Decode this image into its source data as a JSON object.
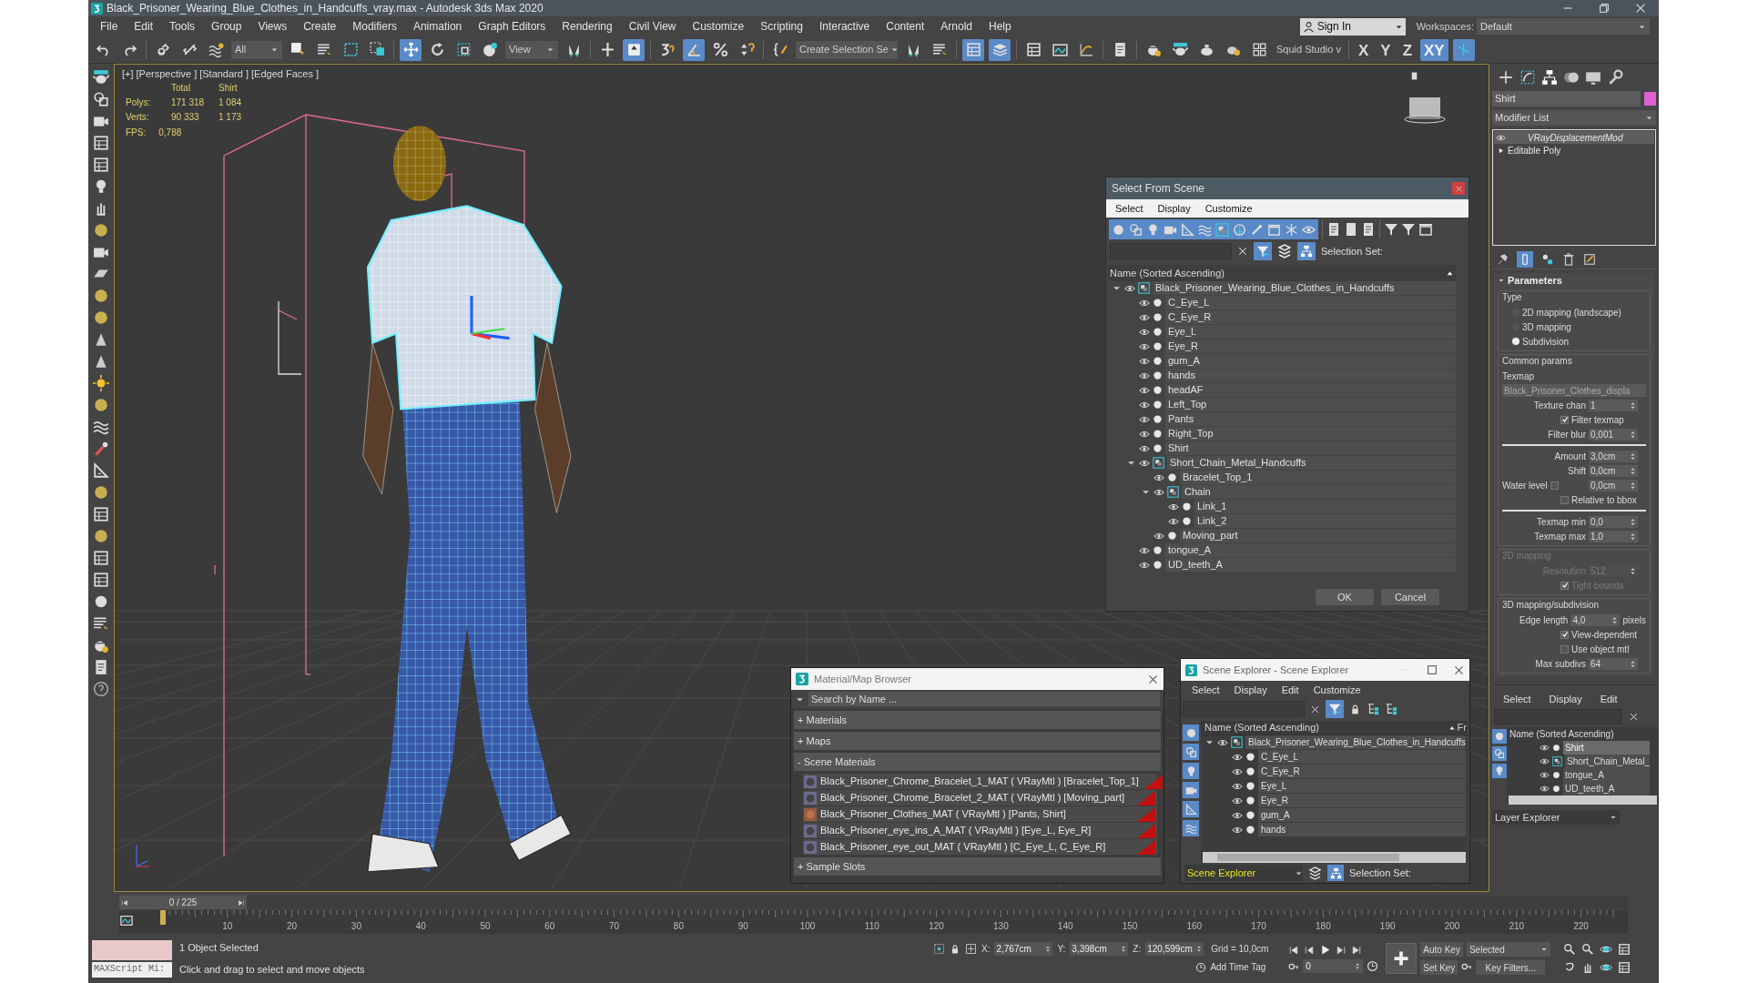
{
  "window": {
    "title": "Black_Prisoner_Wearing_Blue_Clothes_in_Handcuffs_vray.max - Autodesk 3ds Max 2020"
  },
  "menu": [
    "File",
    "Edit",
    "Tools",
    "Group",
    "Views",
    "Create",
    "Modifiers",
    "Animation",
    "Graph Editors",
    "Rendering",
    "Civil View",
    "Customize",
    "Scripting",
    "Interactive",
    "Content",
    "Arnold",
    "Help"
  ],
  "account": {
    "sign_in": "Sign In",
    "workspaces_label": "Workspaces:",
    "workspace": "Default"
  },
  "toolbar": {
    "selection_filter": "All",
    "reference_coordinate": "View",
    "named_selection": "Create Selection Se",
    "workspace_menu": "Squid Studio v",
    "axes": [
      {
        "label": "X",
        "selected": false
      },
      {
        "label": "Y",
        "selected": false
      },
      {
        "label": "Z",
        "selected": false
      },
      {
        "label": "XY",
        "selected": true
      }
    ]
  },
  "viewport": {
    "labels": [
      "[+]",
      "[Perspective ]",
      "[Standard ]",
      "[Edged Faces ]"
    ],
    "stats": {
      "columns": [
        "Total",
        "Shirt"
      ],
      "rows": [
        {
          "label": "Polys:",
          "total": "171 318",
          "selection": "1 084"
        },
        {
          "label": "Verts:",
          "total": "90 333",
          "selection": "1 173"
        }
      ],
      "fps_label": "FPS:",
      "fps": "0,788"
    }
  },
  "select_from_scene": {
    "title": "Select From Scene",
    "menu": [
      "Select",
      "Display",
      "Customize"
    ],
    "selection_set_label": "Selection Set:",
    "column": "Name (Sorted Ascending)",
    "tree": [
      {
        "name": "Black_Prisoner_Wearing_Blue_Clothes_in_Handcuffs",
        "kind": "group",
        "expanded": true,
        "children": [
          {
            "name": "C_Eye_L",
            "kind": "object"
          },
          {
            "name": "C_Eye_R",
            "kind": "object"
          },
          {
            "name": "Eye_L",
            "kind": "object"
          },
          {
            "name": "Eye_R",
            "kind": "object"
          },
          {
            "name": "gum_A",
            "kind": "object"
          },
          {
            "name": "hands",
            "kind": "object"
          },
          {
            "name": "headAF",
            "kind": "object"
          },
          {
            "name": "Left_Top",
            "kind": "object"
          },
          {
            "name": "Pants",
            "kind": "object"
          },
          {
            "name": "Right_Top",
            "kind": "object"
          },
          {
            "name": "Shirt",
            "kind": "object"
          },
          {
            "name": "Short_Chain_Metal_Handcuffs",
            "kind": "group",
            "expanded": true,
            "children": [
              {
                "name": "Bracelet_Top_1",
                "kind": "object"
              },
              {
                "name": "Chain",
                "kind": "group",
                "expanded": true,
                "children": [
                  {
                    "name": "Link_1",
                    "kind": "object"
                  },
                  {
                    "name": "Link_2",
                    "kind": "object"
                  }
                ]
              },
              {
                "name": "Moving_part",
                "kind": "object"
              }
            ]
          },
          {
            "name": "tongue_A",
            "kind": "object"
          },
          {
            "name": "UD_teeth_A",
            "kind": "object"
          }
        ]
      }
    ],
    "buttons": [
      "OK",
      "Cancel"
    ]
  },
  "material_browser": {
    "title": "Material/Map Browser",
    "placeholder": "Search by Name ...",
    "sections": [
      {
        "label": "+ Materials"
      },
      {
        "label": "+ Maps"
      },
      {
        "label": "- Scene Materials",
        "items": [
          "Black_Prisoner_Chrome_Bracelet_1_MAT ( VRayMtl ) [Bracelet_Top_1]",
          "Black_Prisoner_Chrome_Bracelet_2_MAT ( VRayMtl ) [Moving_part]",
          "Black_Prisoner_Clothes_MAT ( VRayMtl ) [Pants, Shirt]",
          "Black_Prisoner_eye_ins_A_MAT ( VRayMtl ) [Eye_L, Eye_R]",
          "Black_Prisoner_eye_out_MAT ( VRayMtl ) [C_Eye_L, C_Eye_R]"
        ]
      },
      {
        "label": "+ Sample Slots"
      }
    ]
  },
  "scene_explorer": {
    "title": "Scene Explorer - Scene Explorer",
    "menu": [
      "Select",
      "Display",
      "Edit",
      "Customize"
    ],
    "column": "Name (Sorted Ascending)",
    "column_2": "Fr",
    "tree": [
      {
        "name": "Black_Prisoner_Wearing_Blue_Clothes_in_Handcuffs",
        "kind": "group",
        "expanded": true,
        "children": [
          {
            "name": "C_Eye_L",
            "kind": "object"
          },
          {
            "name": "C_Eye_R",
            "kind": "object"
          },
          {
            "name": "Eye_L",
            "kind": "object"
          },
          {
            "name": "Eye_R",
            "kind": "object"
          },
          {
            "name": "gum_A",
            "kind": "object"
          },
          {
            "name": "hands",
            "kind": "object"
          }
        ]
      }
    ],
    "explorer_name": "Scene Explorer",
    "selection_set_label": "Selection Set:"
  },
  "command_panel": {
    "object_name": "Shirt",
    "modifier_list": "Modifier List",
    "stack": [
      {
        "name": "VRayDisplacementMod",
        "selected": true
      },
      {
        "name": "Editable Poly",
        "selected": false
      }
    ],
    "rollout": "Parameters",
    "groups": [
      {
        "title": "Type",
        "disabled": false,
        "rows": [
          {
            "kind": "radio",
            "label": "2D mapping (landscape)",
            "selected": false
          },
          {
            "kind": "radio",
            "label": "3D mapping",
            "selected": false
          },
          {
            "kind": "radio",
            "label": "Subdivision",
            "selected": true
          }
        ]
      },
      {
        "title": "Common params",
        "disabled": false,
        "rows": [
          {
            "kind": "label",
            "label": "Texmap"
          },
          {
            "kind": "map",
            "value": "Black_Prisoner_Clothes_displa"
          },
          {
            "kind": "spinner",
            "label": "Texture chan",
            "value": "1"
          },
          {
            "kind": "checkbox",
            "label": "Filter texmap",
            "checked": true
          },
          {
            "kind": "spinner",
            "label": "Filter blur",
            "value": "0,001"
          },
          {
            "kind": "rule"
          },
          {
            "kind": "spinner",
            "label": "Amount",
            "value": "3,0cm"
          },
          {
            "kind": "spinner",
            "label": "Shift",
            "value": "0,0cm"
          },
          {
            "kind": "checkspinner",
            "label": "Water level",
            "checked": false,
            "value": "0,0cm"
          },
          {
            "kind": "checkbox",
            "label": "Relative to bbox",
            "checked": false
          },
          {
            "kind": "rule"
          },
          {
            "kind": "spinner",
            "label": "Texmap min",
            "value": "0,0"
          },
          {
            "kind": "spinner",
            "label": "Texmap max",
            "value": "1,0"
          }
        ]
      },
      {
        "title": "2D mapping",
        "disabled": true,
        "rows": [
          {
            "kind": "spinner",
            "label": "Resolution",
            "value": "512"
          },
          {
            "kind": "checkbox",
            "label": "Tight bounds",
            "checked": true
          }
        ]
      },
      {
        "title": "3D mapping/subdivision",
        "disabled": false,
        "rows": [
          {
            "kind": "spinner",
            "label": "Edge length",
            "value": "4,0",
            "unit": "pixels"
          },
          {
            "kind": "checkbox",
            "label": "View-dependent",
            "checked": true
          },
          {
            "kind": "checkbox",
            "label": "Use object mtl",
            "checked": false
          },
          {
            "kind": "spinner",
            "label": "Max subdivs",
            "value": "64"
          }
        ]
      }
    ]
  },
  "layer_explorer": {
    "menu": [
      "Select",
      "Display",
      "Edit"
    ],
    "column": "Name (Sorted Ascending)",
    "items": [
      {
        "name": "Shirt",
        "kind": "object",
        "selected": true
      },
      {
        "name": "Short_Chain_Metal_",
        "kind": "group",
        "selected": false
      },
      {
        "name": "tongue_A",
        "kind": "object",
        "selected": false
      },
      {
        "name": "UD_teeth_A",
        "kind": "object",
        "selected": false
      }
    ],
    "explorer_name": "Layer Explorer"
  },
  "timeline": {
    "position": "0 / 225",
    "level": 0,
    "ticks": [
      "10",
      "20",
      "30",
      "40",
      "50",
      "60",
      "70",
      "80",
      "90",
      "100",
      "110",
      "120",
      "130",
      "140",
      "150",
      "160",
      "170",
      "180",
      "190",
      "200",
      "210",
      "220"
    ]
  },
  "status": {
    "maxscript": "MAXScript Mi:",
    "selected": "1 Object Selected",
    "prompt": "Click and drag to select and move objects",
    "coords": [
      {
        "axis": "X:",
        "value": "2,767cm"
      },
      {
        "axis": "Y:",
        "value": "3,398cm"
      },
      {
        "axis": "Z:",
        "value": "120,599cm"
      }
    ],
    "grid": "Grid = 10,0cm",
    "time_tag": "Add Time Tag",
    "frame": "0",
    "auto_key": "Auto Key",
    "key_mode": "Selected",
    "set_key": "Set Key",
    "key_filters": "Key Filters..."
  }
}
